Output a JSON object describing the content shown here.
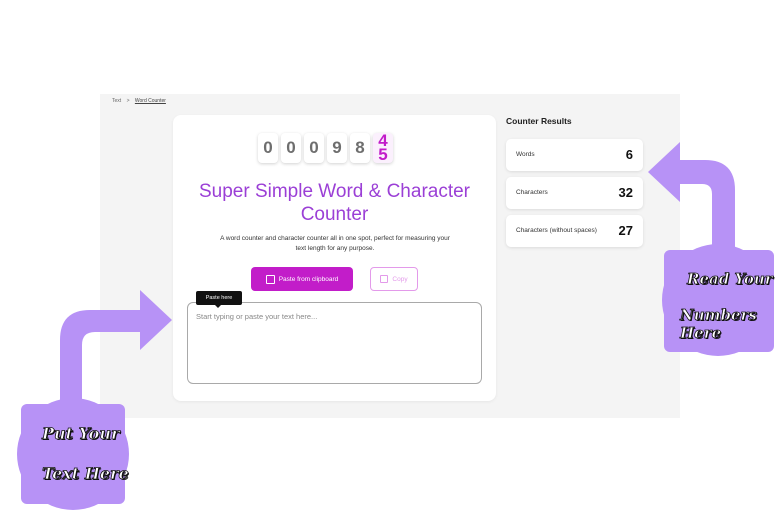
{
  "breadcrumb": {
    "root": "Text",
    "separator": ">",
    "current": "Word Counter"
  },
  "counter_digits": [
    "0",
    "0",
    "0",
    "9",
    "8"
  ],
  "counter_rolling": [
    "4",
    "5"
  ],
  "title": {
    "line1": "Super Simple Word & Character",
    "line2": "Counter"
  },
  "description": {
    "line1": "A word counter and character counter all in one spot, perfect for measuring your",
    "line2": "text length for any purpose."
  },
  "buttons": {
    "paste": "Paste from clipboard",
    "copy": "Copy"
  },
  "tooltip": "Paste here",
  "textarea": {
    "placeholder": "Start typing or paste your text here..."
  },
  "results": {
    "title": "Counter Results",
    "items": [
      {
        "label": "Words",
        "value": "6"
      },
      {
        "label": "Characters",
        "value": "32"
      },
      {
        "label": "Characters (without spaces)",
        "value": "27"
      }
    ]
  },
  "callouts": {
    "left": {
      "line1": "Put Your",
      "line2": "Text Here"
    },
    "right": {
      "line1": "Read Your",
      "line2": "Numbers Here"
    }
  },
  "colors": {
    "accent": "#c21dc9",
    "title": "#9b3fd6",
    "callout": "#b792f6"
  },
  "icons": {
    "paste": "clipboard-icon",
    "copy": "copy-icon",
    "arrow": "curved-arrow-icon"
  }
}
